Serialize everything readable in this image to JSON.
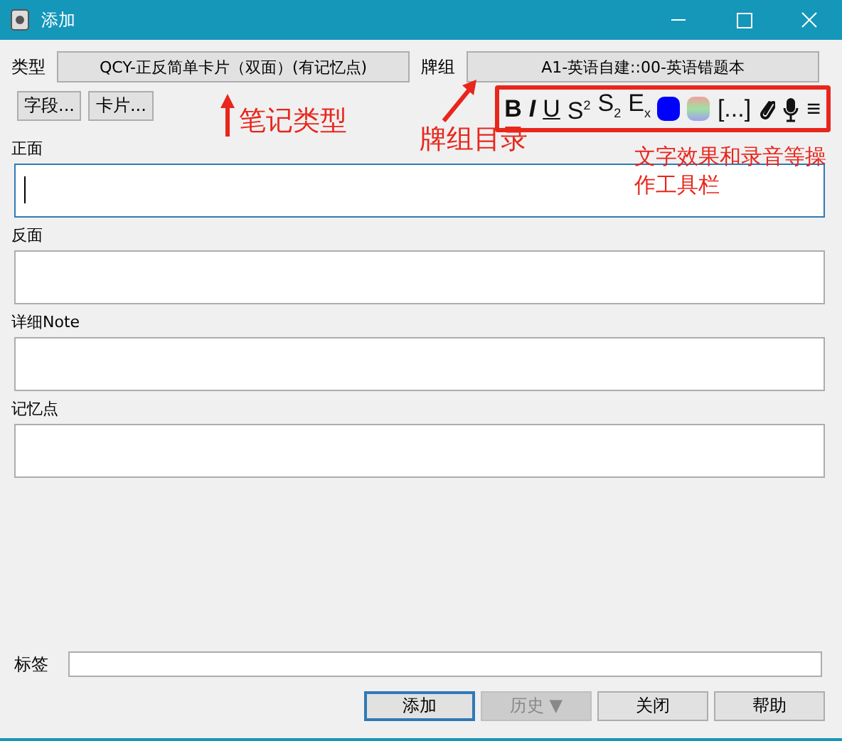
{
  "window": {
    "title": "添加"
  },
  "note_type": {
    "label": "类型",
    "value": "QCY-正反简单卡片（双面）(有记忆点)"
  },
  "deck": {
    "label": "牌组",
    "value": "A1-英语自建::00-英语错题本"
  },
  "left_buttons": [
    "字段...",
    "卡片..."
  ],
  "toolbar": [
    {
      "kind": "bold",
      "label": "B"
    },
    {
      "kind": "italic",
      "label": "I"
    },
    {
      "kind": "underline",
      "label": "U"
    },
    {
      "kind": "text",
      "label": "S$^{2}$"
    },
    {
      "kind": "text",
      "label": "S$_{2}$"
    },
    {
      "kind": "text",
      "label": "E$_{x}$"
    },
    {
      "kind": "swatch",
      "color": "#0000ff"
    },
    {
      "kind": "gradient"
    },
    {
      "kind": "text",
      "label": "[...]"
    },
    {
      "kind": "clip"
    },
    {
      "kind": "mic"
    },
    {
      "kind": "text",
      "label": "≡"
    }
  ],
  "fields": [
    {
      "label": "正面",
      "focused": true
    },
    {
      "label": "反面",
      "focused": false
    },
    {
      "label": "详细Note",
      "focused": false
    },
    {
      "label": "记忆点",
      "focused": false
    }
  ],
  "tags": {
    "label": "标签"
  },
  "buttons": [
    {
      "label": "添加",
      "default": true,
      "disabled": false
    },
    {
      "label": "历史 ▼",
      "default": false,
      "disabled": true
    },
    {
      "label": "关闭",
      "default": false,
      "disabled": false
    },
    {
      "label": "帮助",
      "default": false,
      "disabled": false
    }
  ],
  "annotations": [
    {
      "kind": "note-type",
      "text": "笔记类型"
    },
    {
      "kind": "deck",
      "text": "牌组目录"
    },
    {
      "kind": "toolbar",
      "text": "文字效果和录音等操作工具栏"
    }
  ]
}
